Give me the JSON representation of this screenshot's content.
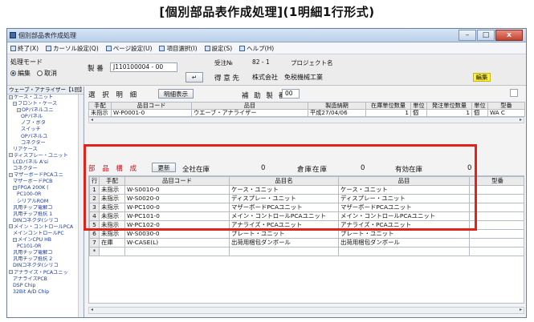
{
  "page_title": "[個別部品表作成処理](1明細1行形式)",
  "window": {
    "title": "個別部品表作成処理",
    "buttons": {
      "minimize": "–",
      "maximize": "□",
      "close": "x"
    }
  },
  "menu": [
    {
      "icon": "exit-icon",
      "label": "終了(X)"
    },
    {
      "icon": "cursor-icon",
      "label": "カーソル設定(Q)"
    },
    {
      "icon": "page-icon",
      "label": "ページ設定(U)"
    },
    {
      "icon": "items-icon",
      "label": "項目選択(I)"
    },
    {
      "icon": "settings-icon",
      "label": "設定(S)"
    },
    {
      "icon": "help-icon",
      "label": "ヘルプ(H)"
    }
  ],
  "header": {
    "mode_label": "処理モード",
    "mode_options": [
      "編集",
      "取消"
    ],
    "mode_selected": "編集",
    "part_label": "製 番",
    "part_value": "J110100004 - 00",
    "order_no_label": "受注№",
    "order_no_value": "82 -   1",
    "project_label": "プロジェクト名",
    "enter_label": "↵",
    "customer_label": "得 意 先",
    "customer_value": "株式会社　免税機械工業",
    "edit_badge": "編集"
  },
  "tree": {
    "header": "ウェーブ・アナライザー【1回】",
    "items": [
      {
        "expander": "−",
        "label": "ケース・ユニット",
        "indent": 0
      },
      {
        "expander": "−",
        "label": "フロント・ケース",
        "indent": 1
      },
      {
        "expander": "−",
        "label": "OPパネルユニ",
        "indent": 2
      },
      {
        "expander": "",
        "label": "OPパネル",
        "indent": 3
      },
      {
        "expander": "",
        "label": "ノブ・ボタ",
        "indent": 3
      },
      {
        "expander": "",
        "label": "スイッチ",
        "indent": 3
      },
      {
        "expander": "",
        "label": "OPパネルユ",
        "indent": 3
      },
      {
        "expander": "",
        "label": "コネクター",
        "indent": 3
      },
      {
        "expander": "",
        "label": "リアケース",
        "indent": 1
      },
      {
        "expander": "−",
        "label": "ディスプレー・ユニット",
        "indent": 0
      },
      {
        "expander": "",
        "label": "LCDパネル A'si",
        "indent": 1
      },
      {
        "expander": "",
        "label": "コネクター",
        "indent": 1
      },
      {
        "expander": "−",
        "label": "マザーボードPCAユニ",
        "indent": 0
      },
      {
        "expander": "",
        "label": "マザーボードPCB",
        "indent": 1
      },
      {
        "expander": "−",
        "label": "FPGA 200K (",
        "indent": 1
      },
      {
        "expander": "",
        "label": "PC100-0R",
        "indent": 2
      },
      {
        "expander": "",
        "label": "シリアルROM",
        "indent": 2
      },
      {
        "expander": "",
        "label": "汎用チップ電解コ",
        "indent": 1
      },
      {
        "expander": "",
        "label": "汎用チップ抵抗 1",
        "indent": 1
      },
      {
        "expander": "",
        "label": "DINコネクタ(シリコ",
        "indent": 1
      },
      {
        "expander": "−",
        "label": "メイン・コントロールPCA",
        "indent": 0
      },
      {
        "expander": "",
        "label": "メインコントロールPC",
        "indent": 1
      },
      {
        "expander": "−",
        "label": "メインCPU HB",
        "indent": 1
      },
      {
        "expander": "",
        "label": "PC101-0R",
        "indent": 2
      },
      {
        "expander": "",
        "label": "汎用チップ電解コ",
        "indent": 1
      },
      {
        "expander": "",
        "label": "汎用チップ抵抗 2",
        "indent": 1
      },
      {
        "expander": "",
        "label": "DINコネクタ(シリコ",
        "indent": 1
      },
      {
        "expander": "−",
        "label": "アナライズ・PCAユニッ",
        "indent": 0
      },
      {
        "expander": "",
        "label": "アナライズPCB",
        "indent": 1
      },
      {
        "expander": "",
        "label": "DSP Chip",
        "indent": 1
      },
      {
        "expander": "",
        "label": "32Bit A/D Chip",
        "indent": 1
      }
    ]
  },
  "selection": {
    "label": "選 択 明 細",
    "display_button": "明細表示",
    "supplement_label": "補 助 製 番",
    "supplement_value": "00",
    "columns": [
      "手配",
      "品目コード",
      "品目",
      "製造納期",
      "在庫単位数量",
      "単位",
      "発注単位数量",
      "単位",
      "型番"
    ],
    "rows": [
      [
        "未指示",
        "W-P0001-0",
        "ウエーブ・アナライザー",
        "平成27/04/06",
        "1",
        "個",
        "1",
        "個",
        "WA C"
      ]
    ]
  },
  "composition": {
    "label": "部 品 構 成",
    "update_button": "更新",
    "stock_total_label": "全社在庫",
    "stock_total_value": "0",
    "warehouse_label": "倉庫在庫",
    "warehouse_value": "0",
    "valid_label": "有効在庫",
    "valid_value": "0",
    "columns": [
      "行",
      "手配",
      "品目コード",
      "品目名",
      "品目",
      "型番"
    ],
    "rows": [
      [
        "1",
        "未指示",
        "W-S0010-0",
        "ケース・ユニット",
        "ケース・ユニット",
        ""
      ],
      [
        "2",
        "未指示",
        "W-S0020-0",
        "ディスプレー・ユニット",
        "ディスプレー・ユニット",
        ""
      ],
      [
        "3",
        "未指示",
        "W-PC100-0",
        "マザーボードPCAユニット",
        "マザーボードPCAユニット",
        ""
      ],
      [
        "4",
        "未指示",
        "W-PC101-0",
        "メイン・コントロールPCAユニット",
        "メイン・コントロールPCAユニット",
        ""
      ],
      [
        "5",
        "未指示",
        "W-PC102-0",
        "アナライズ・PCAユニット",
        "アナライズ・PCAユニット",
        ""
      ],
      [
        "6",
        "未指示",
        "W-S0030-0",
        "プレート・ユニット",
        "プレート・ユニット",
        ""
      ],
      [
        "7",
        "在庫",
        "W-CASE(L)",
        "出荷用梱包ダンボール",
        "出荷用梱包ダンボール",
        ""
      ],
      [
        "*",
        "",
        "",
        "",
        "",
        ""
      ]
    ]
  },
  "highlight_color": "#e2231a"
}
